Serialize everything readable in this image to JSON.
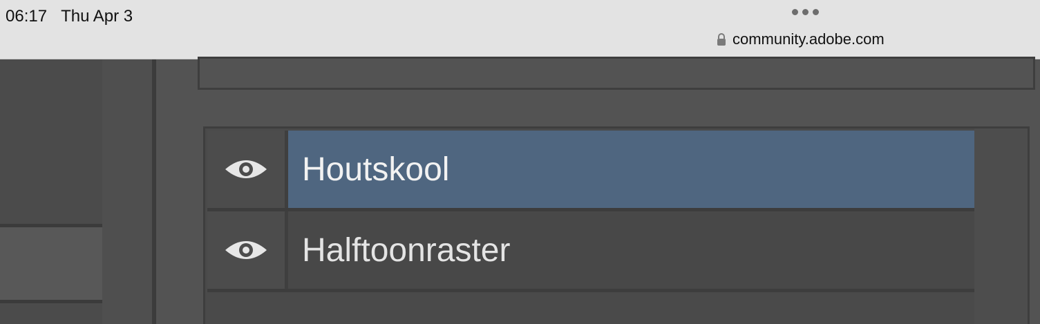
{
  "status_bar": {
    "time": "06:17",
    "date": "Thu Apr 3",
    "url": "community.adobe.com",
    "more_icon": "three-dots-icon",
    "lock_icon": "lock-icon"
  },
  "layers": {
    "items": [
      {
        "name": "Houtskool",
        "visible_icon": "eye-icon",
        "selected": true
      },
      {
        "name": "Halftoonraster",
        "visible_icon": "eye-icon",
        "selected": false
      }
    ]
  },
  "colors": {
    "selected_row": "#4f6680",
    "panel_bg": "#535353",
    "status_bg": "#e3e3e3"
  }
}
